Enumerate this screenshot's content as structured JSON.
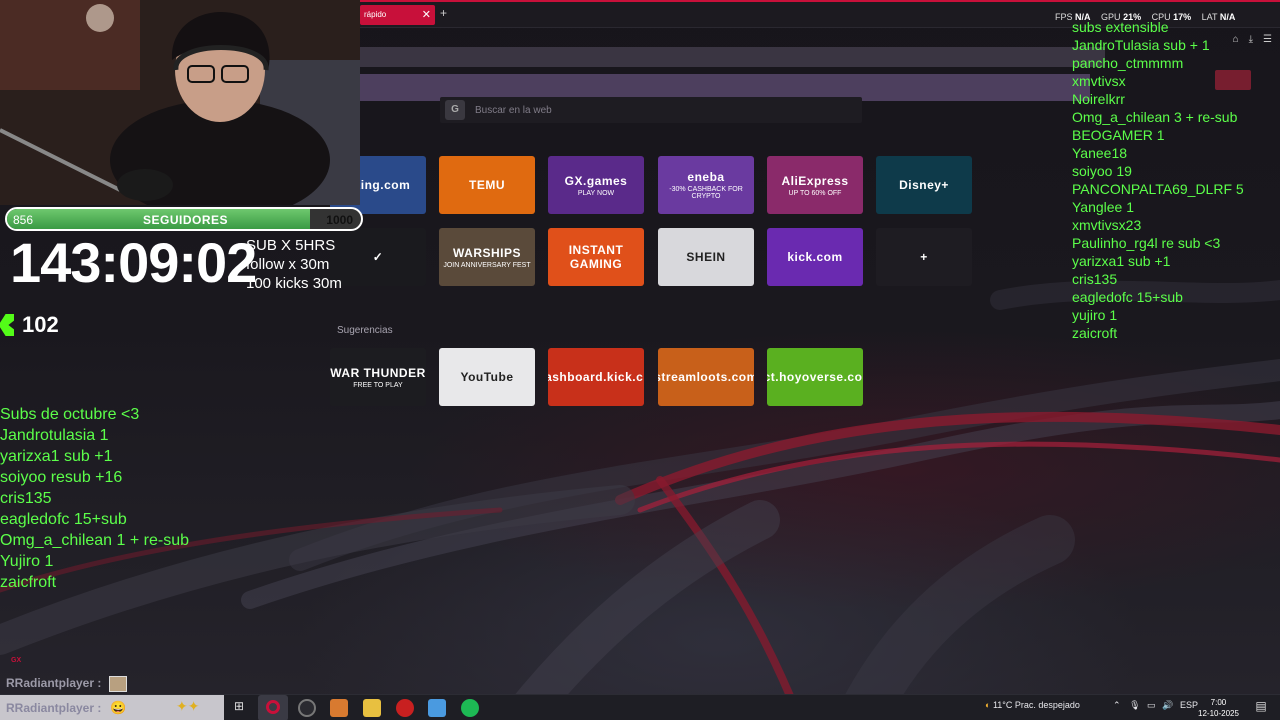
{
  "browser": {
    "tab_label": "rápido",
    "tab_close": "✕",
    "new_tab": "+",
    "search_placeholder": "Buscar en la web",
    "stats": {
      "fps_label": "FPS",
      "fps": "N/A",
      "gpu_label": "GPU",
      "gpu": "21%",
      "cpu_label": "CPU",
      "cpu": "17%",
      "lat_label": "LAT",
      "lat": "N/A"
    },
    "window_icons": [
      "⌂",
      "⤓",
      "☰"
    ]
  },
  "speed_dial": {
    "row1": [
      {
        "label": "oking.com",
        "bg": "#2a4a8a"
      },
      {
        "label": "TEMU",
        "bg": "#e06a10"
      },
      {
        "label": "GX.games",
        "sub": "PLAY NOW",
        "bg": "#5a2a8a"
      },
      {
        "label": "eneba",
        "sub": "-30% CASHBACK FOR CRYPTO",
        "bg": "#6a3aa0"
      },
      {
        "label": "AliExpress",
        "sub": "UP TO 60% OFF",
        "bg": "#8a2a6a"
      },
      {
        "label": "Disney+",
        "bg": "#0e3a4a"
      }
    ],
    "row2": [
      {
        "label": "✓",
        "bg": "#1a1a1e"
      },
      {
        "label": "WARSHIPS",
        "sub": "JOIN ANNIVERSARY FEST",
        "bg": "#5a4a3a"
      },
      {
        "label": "INSTANT GAMING",
        "bg": "#e0501a"
      },
      {
        "label": "SHEIN",
        "bg": "#d8d8dc"
      },
      {
        "label": "kick.com",
        "bg": "#6a2ab0"
      },
      {
        "label": "+",
        "bg": "#1e1c22"
      }
    ],
    "suggestions_title": "Sugerencias",
    "suggestions": [
      {
        "label": "WAR THUNDER",
        "sub": "FREE TO PLAY",
        "bg": "#1c1c20"
      },
      {
        "label": "YouTube",
        "bg": "#e8e8ea"
      },
      {
        "label": "dashboard.kick.c...",
        "bg": "#c8301a"
      },
      {
        "label": "streamloots.com",
        "bg": "#c8601a"
      },
      {
        "label": "act.hoyoverse.com",
        "bg": "#5ab020"
      }
    ]
  },
  "overlay": {
    "followers_current": "856",
    "followers_label": "SEGUIDORES",
    "followers_goal": "1000",
    "followers_progress": 0.856,
    "timer": "143:09:02",
    "timer_rules": [
      "SUB X 5HRS",
      "follow x 30m",
      "100 kicks 30m"
    ],
    "kick_count": "102",
    "subs_left": [
      "Subs de octubre <3",
      "Jandrotulasia 1",
      "yarizxa1 sub +1",
      "soiyoo resub +16",
      "cris135",
      "eagledofc 15+sub",
      "Omg_a_chilean 1 + re-sub",
      "Yujiro 1",
      "zaicfroft"
    ],
    "subs_right": [
      "subs extensible",
      "JandroTulasia sub + 1",
      "pancho_ctmmmm",
      "xmvtivsx",
      "Noirelkrr",
      "Omg_a_chilean 3 + re-sub",
      "BEOGAMER 1",
      "Yanee18",
      "soiyoo 19",
      "PANCONPALTA69_DLRF 5",
      "Yanglee 1",
      "xmvtivsx23",
      "Paulinho_rg4l  re sub <3",
      "yarizxa1 sub +1",
      "cris135",
      "eagledofc 15+sub",
      "yujiro 1",
      "zaicroft"
    ],
    "gx_mark": "GX",
    "chat_user_1": "RRadiantplayer :",
    "chat_user_2": "RRadiantplayer :"
  },
  "taskbar": {
    "weather": "11°C  Prac. despejado",
    "lang": "ESP",
    "time": "7:00",
    "date": "12-10-2025"
  }
}
